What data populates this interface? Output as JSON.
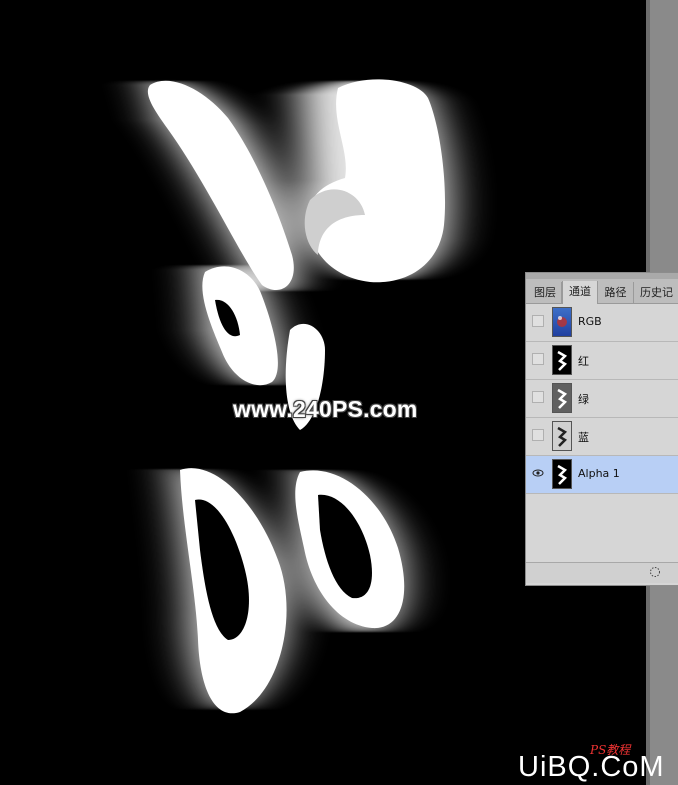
{
  "watermark": "www.240PS.com",
  "channels_panel": {
    "tabs": [
      {
        "label": "图层",
        "active": false
      },
      {
        "label": "通道",
        "active": true
      },
      {
        "label": "路径",
        "active": false
      },
      {
        "label": "历史记",
        "active": false
      }
    ],
    "channels": [
      {
        "name": "RGB",
        "thumb": "rgb",
        "visible": false,
        "selected": false
      },
      {
        "name": "红",
        "thumb": "dark",
        "visible": false,
        "selected": false
      },
      {
        "name": "绿",
        "thumb": "green",
        "visible": false,
        "selected": false
      },
      {
        "name": "蓝",
        "thumb": "light",
        "visible": false,
        "selected": false
      },
      {
        "name": "Alpha 1",
        "thumb": "dark",
        "visible": true,
        "selected": true
      }
    ],
    "footer_icon": "dotted-selection-icon"
  },
  "logo": {
    "text": "UiBQ.CoM",
    "small_text": "PS教程"
  },
  "colors": {
    "canvas_bg": "#000000",
    "panel_bg": "#d6d6d6",
    "selected_row": "#b8cff5",
    "logo_accent": "#e33333"
  }
}
